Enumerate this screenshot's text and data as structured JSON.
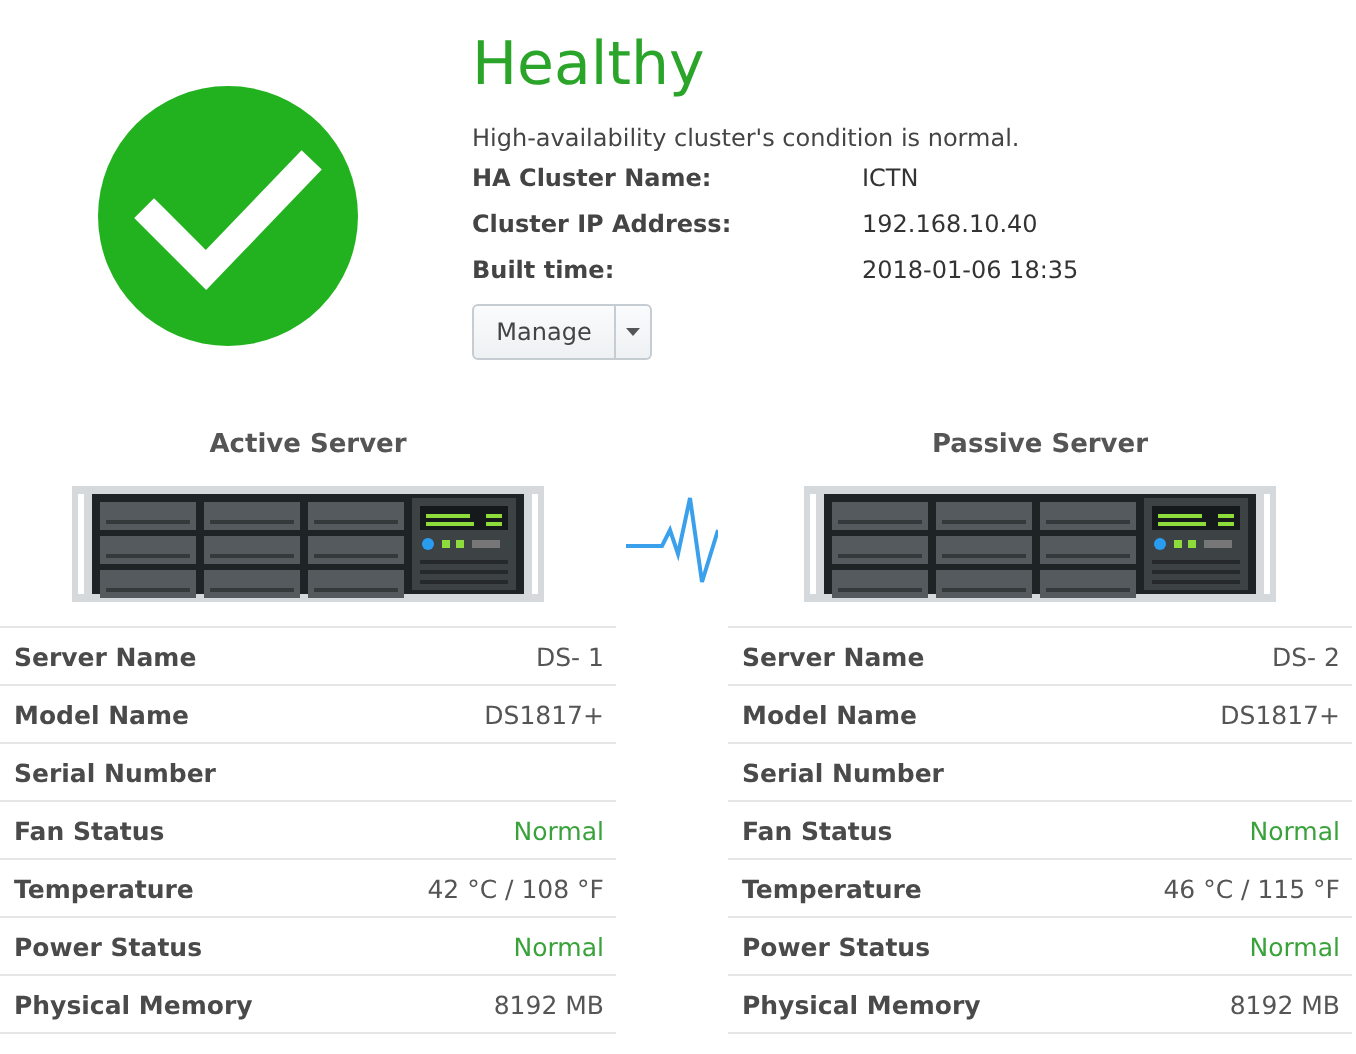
{
  "status": {
    "title": "Healthy",
    "description": "High-availability cluster's condition is normal."
  },
  "cluster_info": [
    {
      "label": "HA Cluster Name:",
      "value": "ICTN"
    },
    {
      "label": "Cluster IP Address:",
      "value": "192.168.10.40"
    },
    {
      "label": "Built time:",
      "value": "2018-01-06 18:35"
    }
  ],
  "manage_button": {
    "label": "Manage"
  },
  "servers": [
    {
      "title": "Active Server",
      "rows": [
        {
          "label": "Server Name",
          "value": "DS- 1",
          "kind": "text"
        },
        {
          "label": "Model Name",
          "value": "DS1817+",
          "kind": "text"
        },
        {
          "label": "Serial Number"
        },
        {
          "label": "Fan Status",
          "value": "Normal",
          "kind": "status"
        },
        {
          "label": "Temperature",
          "value": "42 °C / 108 °F",
          "kind": "text"
        },
        {
          "label": "Power Status",
          "value": "Normal",
          "kind": "status"
        },
        {
          "label": "Physical Memory",
          "value": "8192 MB",
          "kind": "text"
        }
      ]
    },
    {
      "title": "Passive Server",
      "rows": [
        {
          "label": "Server Name",
          "value": "DS- 2",
          "kind": "text"
        },
        {
          "label": "Model Name",
          "value": "DS1817+",
          "kind": "text"
        },
        {
          "label": "Serial Number"
        },
        {
          "label": "Fan Status",
          "value": "Normal",
          "kind": "status"
        },
        {
          "label": "Temperature",
          "value": "46 °C / 115 °F",
          "kind": "text"
        },
        {
          "label": "Power Status",
          "value": "Normal",
          "kind": "status"
        },
        {
          "label": "Physical Memory",
          "value": "8192 MB",
          "kind": "text"
        }
      ]
    }
  ]
}
